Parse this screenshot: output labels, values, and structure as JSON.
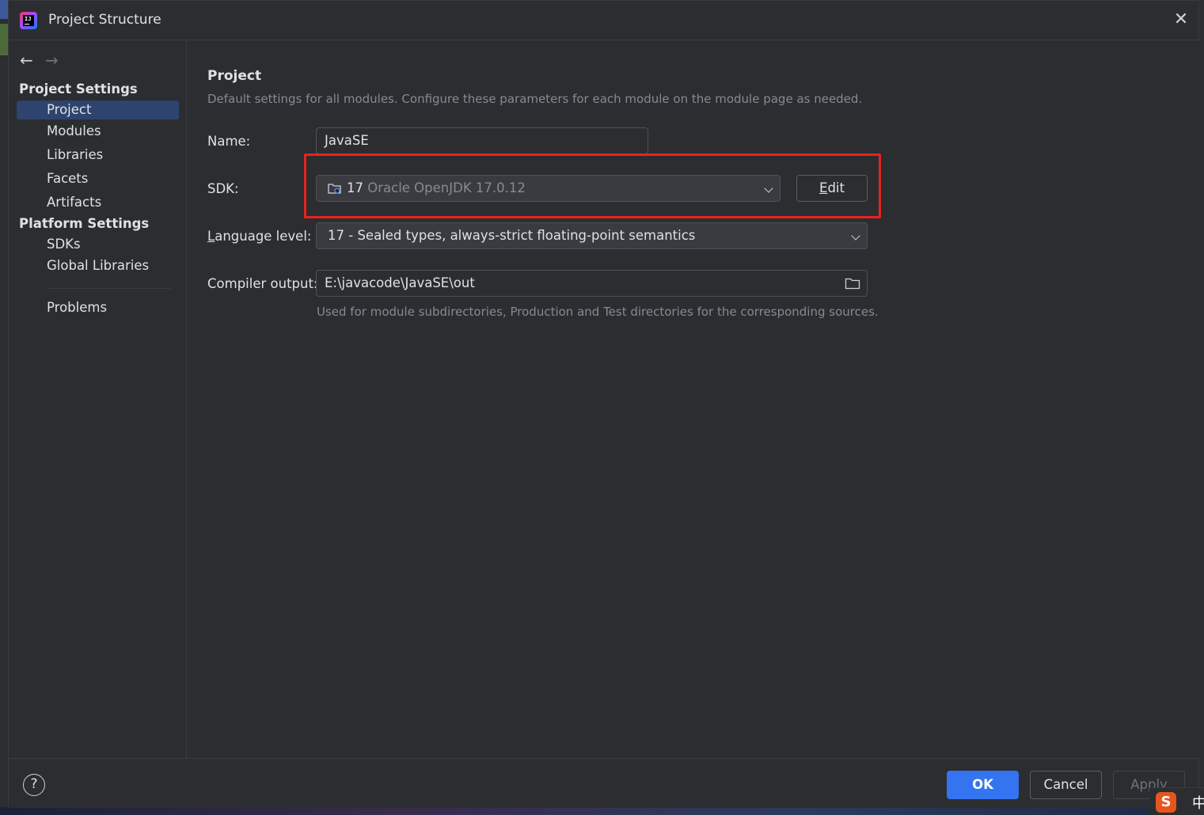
{
  "dialog": {
    "title": "Project Structure",
    "close_glyph": "✕"
  },
  "nav": {
    "back_glyph": "←",
    "forward_glyph": "→"
  },
  "sidebar": {
    "project_settings_header": "Project Settings",
    "project_settings_items": [
      "Project",
      "Modules",
      "Libraries",
      "Facets",
      "Artifacts"
    ],
    "selected_item": "Project",
    "platform_settings_header": "Platform Settings",
    "platform_settings_items": [
      "SDKs",
      "Global Libraries"
    ],
    "problems_label": "Problems"
  },
  "content": {
    "heading": "Project",
    "description": "Default settings for all modules. Configure these parameters for each module on the module page as needed.",
    "name_label": "Name:",
    "name_value": "JavaSE",
    "sdk_label": "SDK:",
    "sdk_version": "17",
    "sdk_name": "Oracle OpenJDK 17.0.12",
    "edit_button": "Edit",
    "language_level_label_prefix": "L",
    "language_level_label_rest": "anguage level:",
    "language_level_value": "17 - Sealed types, always-strict floating-point semantics",
    "compiler_output_label": "Compiler output:",
    "compiler_output_value": "E:\\javacode\\JavaSE\\out",
    "compiler_output_hint": "Used for module subdirectories, Production and Test directories for the corresponding sources."
  },
  "footer": {
    "help_glyph": "?",
    "ok_label": "OK",
    "cancel_label": "Cancel",
    "apply_label": "Apply"
  },
  "taskbar": {
    "ime_logo": "S",
    "ime_language": "中"
  },
  "colors": {
    "accent": "#3574f0",
    "selection": "#2e436e",
    "highlight_box": "#e8231d",
    "background": "#2b2d30"
  },
  "icons": [
    "app-logo",
    "back-arrow-icon",
    "forward-arrow-icon",
    "close-icon",
    "jdk-folder-icon",
    "chevron-down-icon",
    "folder-icon",
    "help-icon"
  ]
}
